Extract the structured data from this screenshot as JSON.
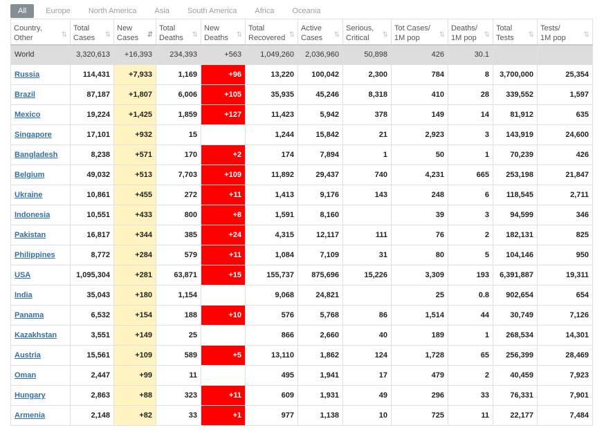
{
  "tabs": [
    "All",
    "Europe",
    "North America",
    "Asia",
    "South America",
    "Africa",
    "Oceania"
  ],
  "columns": [
    {
      "l1": "Country,",
      "l2": "Other"
    },
    {
      "l1": "Total",
      "l2": "Cases"
    },
    {
      "l1": "New",
      "l2": "Cases"
    },
    {
      "l1": "Total",
      "l2": "Deaths"
    },
    {
      "l1": "New",
      "l2": "Deaths"
    },
    {
      "l1": "Total",
      "l2": "Recovered"
    },
    {
      "l1": "Active",
      "l2": "Cases"
    },
    {
      "l1": "Serious,",
      "l2": "Critical"
    },
    {
      "l1": "Tot Cases/",
      "l2": "1M pop"
    },
    {
      "l1": "Deaths/",
      "l2": "1M pop"
    },
    {
      "l1": "Total",
      "l2": "Tests"
    },
    {
      "l1": "Tests/",
      "l2": "1M pop"
    }
  ],
  "sort_glyph": "⇅",
  "sort_active_glyph": "⇵",
  "world": [
    "World",
    "3,320,613",
    "+16,393",
    "234,393",
    "+563",
    "1,049,260",
    "2,036,960",
    "50,898",
    "426",
    "30.1",
    "",
    ""
  ],
  "rows": [
    [
      "Russia",
      "114,431",
      "+7,933",
      "1,169",
      "+96",
      "13,220",
      "100,042",
      "2,300",
      "784",
      "8",
      "3,700,000",
      "25,354"
    ],
    [
      "Brazil",
      "87,187",
      "+1,807",
      "6,006",
      "+105",
      "35,935",
      "45,246",
      "8,318",
      "410",
      "28",
      "339,552",
      "1,597"
    ],
    [
      "Mexico",
      "19,224",
      "+1,425",
      "1,859",
      "+127",
      "11,423",
      "5,942",
      "378",
      "149",
      "14",
      "81,912",
      "635"
    ],
    [
      "Singapore",
      "17,101",
      "+932",
      "15",
      "",
      "1,244",
      "15,842",
      "21",
      "2,923",
      "3",
      "143,919",
      "24,600"
    ],
    [
      "Bangladesh",
      "8,238",
      "+571",
      "170",
      "+2",
      "174",
      "7,894",
      "1",
      "50",
      "1",
      "70,239",
      "426"
    ],
    [
      "Belgium",
      "49,032",
      "+513",
      "7,703",
      "+109",
      "11,892",
      "29,437",
      "740",
      "4,231",
      "665",
      "253,198",
      "21,847"
    ],
    [
      "Ukraine",
      "10,861",
      "+455",
      "272",
      "+11",
      "1,413",
      "9,176",
      "143",
      "248",
      "6",
      "118,545",
      "2,711"
    ],
    [
      "Indonesia",
      "10,551",
      "+433",
      "800",
      "+8",
      "1,591",
      "8,160",
      "",
      "39",
      "3",
      "94,599",
      "346"
    ],
    [
      "Pakistan",
      "16,817",
      "+344",
      "385",
      "+24",
      "4,315",
      "12,117",
      "111",
      "76",
      "2",
      "182,131",
      "825"
    ],
    [
      "Philippines",
      "8,772",
      "+284",
      "579",
      "+11",
      "1,084",
      "7,109",
      "31",
      "80",
      "5",
      "104,146",
      "950"
    ],
    [
      "USA",
      "1,095,304",
      "+281",
      "63,871",
      "+15",
      "155,737",
      "875,696",
      "15,226",
      "3,309",
      "193",
      "6,391,887",
      "19,311"
    ],
    [
      "India",
      "35,043",
      "+180",
      "1,154",
      "",
      "9,068",
      "24,821",
      "",
      "25",
      "0.8",
      "902,654",
      "654"
    ],
    [
      "Panama",
      "6,532",
      "+154",
      "188",
      "+10",
      "576",
      "5,768",
      "86",
      "1,514",
      "44",
      "30,749",
      "7,126"
    ],
    [
      "Kazakhstan",
      "3,551",
      "+149",
      "25",
      "",
      "866",
      "2,660",
      "40",
      "189",
      "1",
      "268,534",
      "14,301"
    ],
    [
      "Austria",
      "15,561",
      "+109",
      "589",
      "+5",
      "13,110",
      "1,862",
      "124",
      "1,728",
      "65",
      "256,399",
      "28,469"
    ],
    [
      "Oman",
      "2,447",
      "+99",
      "11",
      "",
      "495",
      "1,941",
      "17",
      "479",
      "2",
      "40,459",
      "7,923"
    ],
    [
      "Hungary",
      "2,863",
      "+88",
      "323",
      "+11",
      "609",
      "1,931",
      "49",
      "296",
      "33",
      "76,331",
      "7,901"
    ],
    [
      "Armenia",
      "2,148",
      "+82",
      "33",
      "+1",
      "977",
      "1,138",
      "10",
      "725",
      "11",
      "22,177",
      "7,484"
    ]
  ],
  "colors": {
    "new_cases_bg": "#fff3c1",
    "new_deaths_bg": "#ff0000",
    "world_bg": "#dddddd",
    "link": "#3370a8"
  }
}
